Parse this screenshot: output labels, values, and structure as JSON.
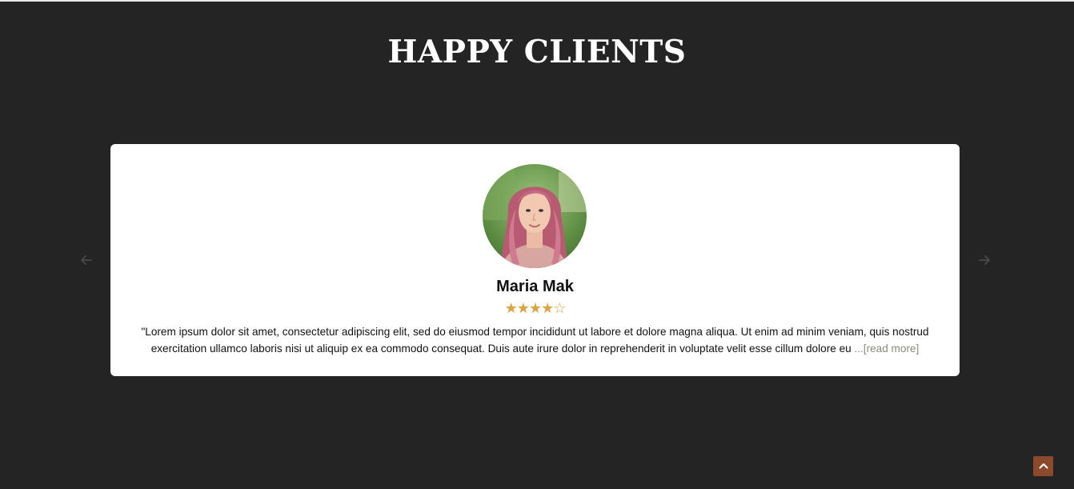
{
  "section": {
    "title": "HAPPY CLIENTS"
  },
  "testimonial": {
    "name": "Maria Mak",
    "rating": 4,
    "rating_max": 5,
    "stars_text": "★★★★☆",
    "review_text": "\"Lorem ipsum dolor sit amet, consectetur adipiscing elit, sed do eiusmod tempor incididunt ut labore et dolore magna aliqua. Ut enim ad minim veniam, quis nostrud exercitation ullamco laboris nisi ut aliquip ex ea commodo consequat. Duis aute irure dolor in reprehenderit in voluptate velit esse cillum dolore eu ",
    "read_more": "...[read more]"
  },
  "nav": {
    "prev_icon": "arrow-left-icon",
    "next_icon": "arrow-right-icon"
  },
  "scroll_top": {
    "icon": "chevron-up-icon"
  },
  "colors": {
    "background": "#242424",
    "card": "#ffffff",
    "star": "#d9a441",
    "scroll_top_bg": "#8b4a2b",
    "read_more": "#8a8a7a"
  }
}
